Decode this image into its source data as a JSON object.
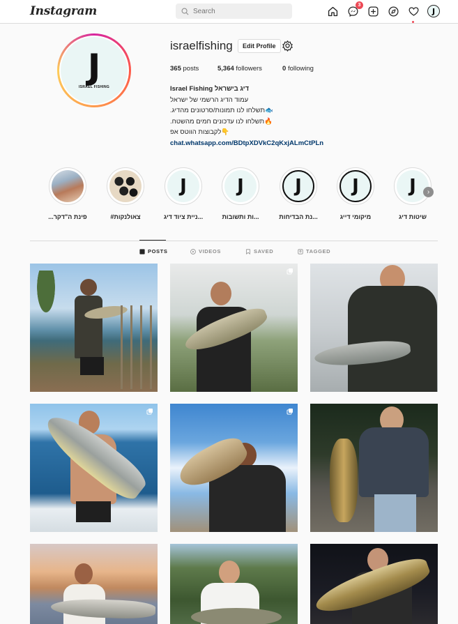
{
  "nav": {
    "logo": "Instagram",
    "search_placeholder": "Search",
    "messages_badge": "3"
  },
  "profile": {
    "username": "israelfishing",
    "edit_label": "Edit Profile",
    "pic_text": "ISRAEL FISHING",
    "posts": "365",
    "posts_label": "posts",
    "followers": "5,364",
    "followers_label": "followers",
    "following": "0",
    "following_label": "following",
    "bio_name": "Israel Fishing דיג בישראל",
    "bio_lines": [
      "עמוד הדיג הרשמי של ישראל",
      ".תשלחו לנו תמונות/סרטונים מהדיג🐟",
      ".תשלחו לנו עדכונים חמים מהשטח🔥",
      "לקבוצות הווטס אפ👇"
    ],
    "bio_link": "chat.whatsapp.com/BDtpXDVkC2qKxjALmCtPLn"
  },
  "highlights": [
    {
      "label": "פינת ה\"דקר..."
    },
    {
      "label": "צאולנקות#"
    },
    {
      "label": "...ניית ציוד דיג"
    },
    {
      "label": "...ות ותשובות"
    },
    {
      "label": "...נת הבדיחות"
    },
    {
      "label": "מיקומי דייג"
    },
    {
      "label": "שיטות דיג"
    }
  ],
  "tabs": [
    {
      "label": "POSTS"
    },
    {
      "label": "VIDEOS"
    },
    {
      "label": "SAVED"
    },
    {
      "label": "TAGGED"
    }
  ]
}
